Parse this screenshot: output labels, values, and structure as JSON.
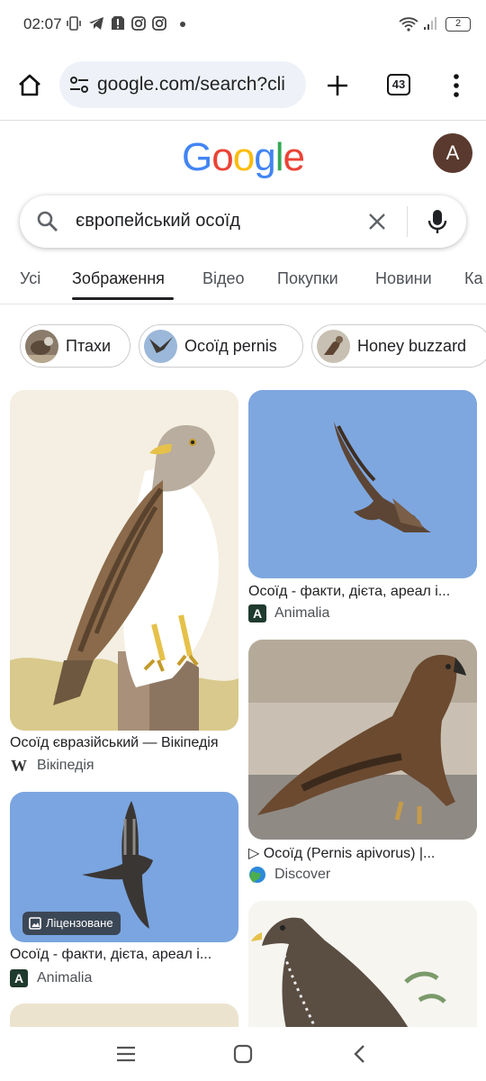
{
  "status_bar": {
    "time": "02:07",
    "battery": "2",
    "icons": [
      "vibrate-icon",
      "telegram-icon",
      "alert-icon",
      "instagram-icon",
      "instagram-icon",
      "dot-icon",
      "wifi-icon",
      "signal-icon",
      "battery-icon"
    ]
  },
  "browser": {
    "url": "google.com/search?cli",
    "tab_count": "43"
  },
  "google": {
    "logo_letters": [
      "G",
      "o",
      "o",
      "g",
      "l",
      "e"
    ],
    "logo_colors": [
      "#4285F4",
      "#EA4335",
      "#FBBC05",
      "#4285F4",
      "#34A853",
      "#EA4335"
    ],
    "avatar_letter": "A",
    "avatar_color": "#5a3a2e"
  },
  "search": {
    "query": "європейський осоїд"
  },
  "nav_tabs": [
    {
      "label": "Усі"
    },
    {
      "label": "Зображення",
      "active": true
    },
    {
      "label": "Відео"
    },
    {
      "label": "Покупки"
    },
    {
      "label": "Новини"
    },
    {
      "label": "Ка"
    }
  ],
  "chips": [
    {
      "label": "Птахи"
    },
    {
      "label": "Осоїд pernis"
    },
    {
      "label": "Honey buzzard"
    }
  ],
  "results": [
    {
      "title": "Осоїд євразійський — Вікіпедія",
      "source": "Вікіпедія",
      "source_icon": "W"
    },
    {
      "title": "Осоїд - факти, дієта, ареал і...",
      "source": "Animalia",
      "source_icon": "A"
    },
    {
      "title": "Осоїд - факти, дієта, ареал і...",
      "source": "Animalia",
      "source_icon": "A",
      "badge": "Ліцензоване"
    },
    {
      "title": "▷ Осоїд (Pernis apivorus) |...",
      "source": "Discover",
      "source_icon": "globe"
    }
  ]
}
